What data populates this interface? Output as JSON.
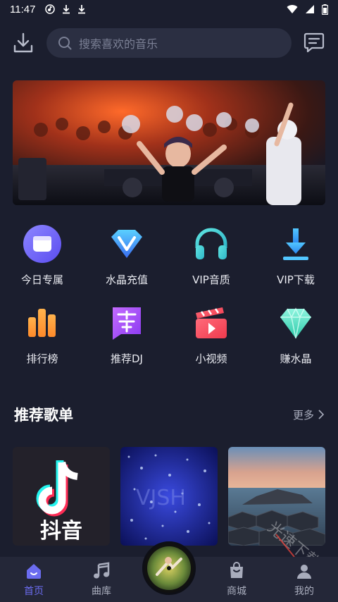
{
  "status_bar": {
    "time": "11:47",
    "icons": [
      "music-notification-icon",
      "download-icon",
      "download-icon"
    ],
    "right_icons": [
      "wifi-icon",
      "signal-icon",
      "battery-icon"
    ]
  },
  "header": {
    "search_placeholder": "搜索喜欢的音乐"
  },
  "quick_grid": [
    {
      "label": "今日专属",
      "icon": "today-exclusive-icon"
    },
    {
      "label": "水晶充值",
      "icon": "crystal-recharge-icon"
    },
    {
      "label": "VIP音质",
      "icon": "headphones-icon"
    },
    {
      "label": "VIP下载",
      "icon": "download-icon"
    },
    {
      "label": "排行榜",
      "icon": "chart-icon"
    },
    {
      "label": "推荐DJ",
      "icon": "recommend-dj-icon"
    },
    {
      "label": "小视频",
      "icon": "video-icon"
    },
    {
      "label": "赚水晶",
      "icon": "diamond-icon"
    }
  ],
  "recommend": {
    "title": "推荐歌单",
    "more": "更多"
  },
  "playlists": [
    {
      "caption": "抖音",
      "name": "douyin-playlist"
    },
    {
      "caption": "",
      "name": "blue-lights-playlist"
    },
    {
      "caption": "",
      "name": "ocean-rocks-playlist"
    }
  ],
  "tabs": [
    {
      "label": "首页",
      "icon": "home-icon",
      "active": true
    },
    {
      "label": "曲库",
      "icon": "music-library-icon",
      "active": false
    },
    {
      "label": "",
      "icon": "now-playing-disc",
      "active": false
    },
    {
      "label": "商城",
      "icon": "shop-icon",
      "active": false
    },
    {
      "label": "我的",
      "icon": "profile-icon",
      "active": false
    }
  ],
  "colors": {
    "background": "#1b1e2e",
    "accent": "#6b6cf0",
    "search_bg": "#2b2f42"
  }
}
